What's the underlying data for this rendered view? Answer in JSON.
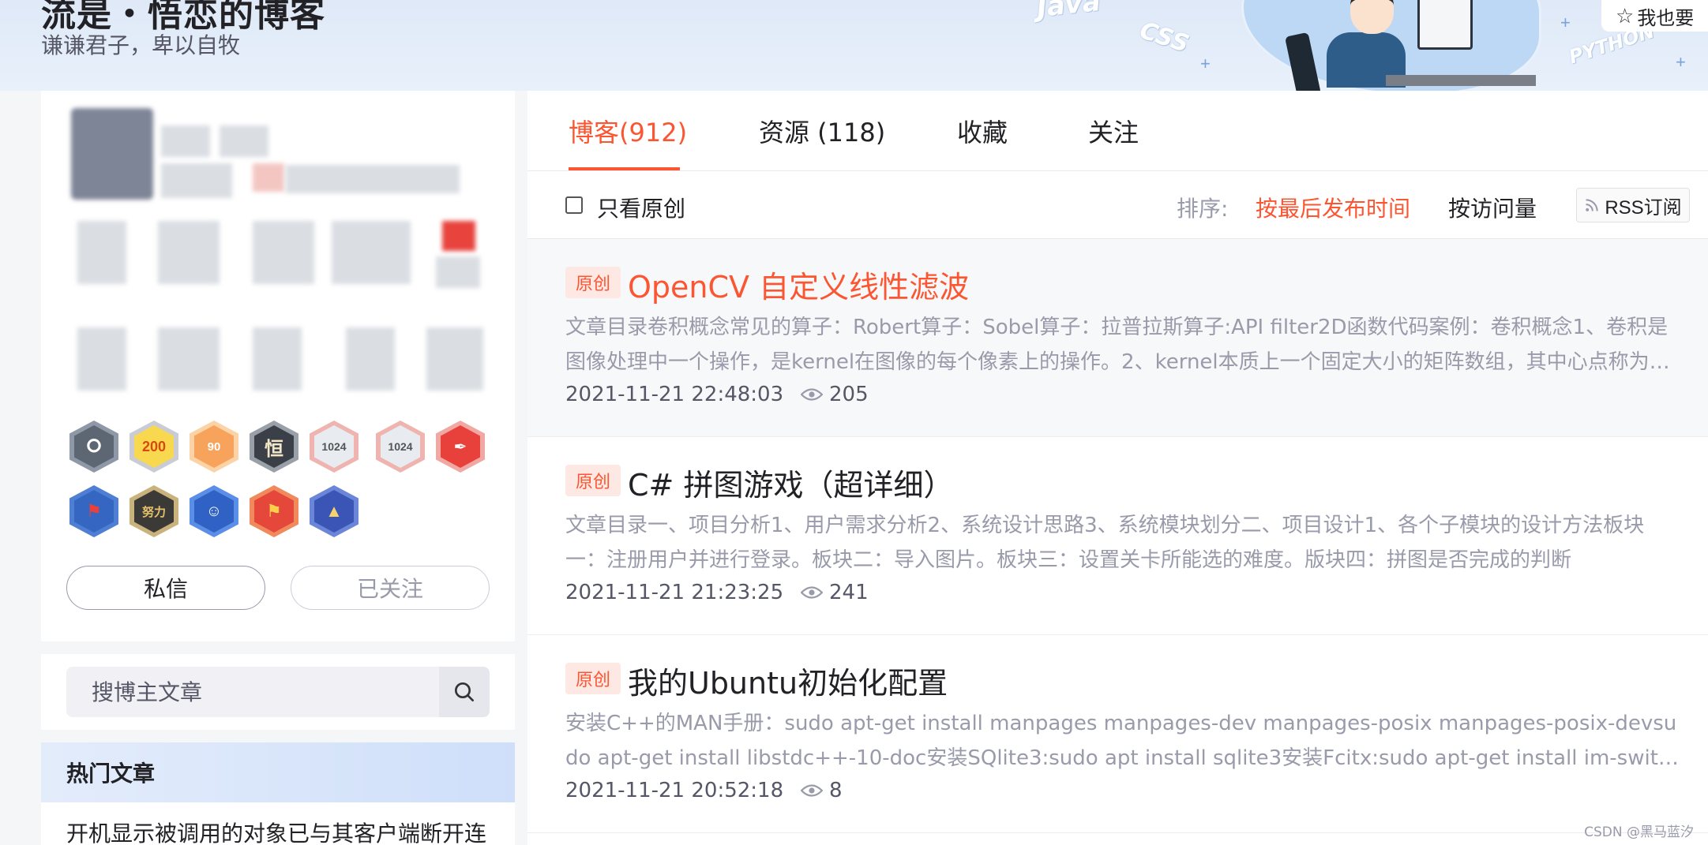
{
  "header": {
    "blog_title": "流是・悟恋的博客",
    "subtitle": "谦谦君子，卑以自牧",
    "decorations": [
      "Java",
      "CSS",
      "PYTHON"
    ],
    "follow_label": "我也要",
    "follow_icon": "star-icon"
  },
  "profile": {
    "message_button": "私信",
    "followed_button": "已关注",
    "badges": [
      "github",
      "200",
      "90",
      "恒",
      "1024",
      "1024",
      "pen",
      "flag",
      "努力",
      "astronaut",
      "flag-5",
      "rocket"
    ]
  },
  "search": {
    "placeholder": "搜博主文章",
    "icon": "search-icon"
  },
  "hot": {
    "title": "热门文章",
    "first_item": "开机显示被调用的对象已与其客户端断开连"
  },
  "tabs": [
    {
      "label": "博客(912)",
      "active": true
    },
    {
      "label": "资源 (118)",
      "active": false
    },
    {
      "label": "收藏",
      "active": false
    },
    {
      "label": "关注",
      "active": false
    }
  ],
  "filter": {
    "original_only": "只看原创",
    "sort_label": "排序:",
    "sort_by_time": "按最后发布时间",
    "sort_by_views": "按访问量",
    "rss": "RSS订阅"
  },
  "articles": [
    {
      "tag": "原创",
      "title": "OpenCV 自定义线性滤波",
      "desc": "文章目录卷积概念常见的算子：Robert算子：Sobel算子：拉普拉斯算子:API filter2D函数代码案例：卷积概念1、卷积是图像处理中一个操作，是kernel在图像的每个像素上的操作。2、kernel本质上一个固定大小的矩阵数组，其中心点称为锚点",
      "date": "2021-11-21 22:48:03",
      "views": "205"
    },
    {
      "tag": "原创",
      "title": "C# 拼图游戏（超详细）",
      "desc": "文章目录一、项目分析1、用户需求分析2、系统设计思路3、系统模块划分二、项目设计1、各个子模块的设计方法板块一：注册用户并进行登录。板块二：导入图片。板块三：设置关卡所能选的难度。版块四：拼图是否完成的判断",
      "date": "2021-11-21 21:23:25",
      "views": "241"
    },
    {
      "tag": "原创",
      "title": "我的Ubuntu初始化配置",
      "desc": "安装C++的MAN手册：sudo apt-get install manpages manpages-dev manpages-posix manpages-posix-devsudo apt-get install libstdc++-10-doc安装SQlite3:sudo apt install sqlite3安装Fcitx:sudo apt-get install im-switch libapt-pkg-perl",
      "date": "2021-11-21 20:52:18",
      "views": "8"
    }
  ],
  "watermark": "CSDN @黑马蓝汐",
  "colors": {
    "accent": "#fc5531",
    "text_primary": "#222226",
    "text_muted": "#999aaa",
    "page_bg": "#f5f6f7"
  }
}
